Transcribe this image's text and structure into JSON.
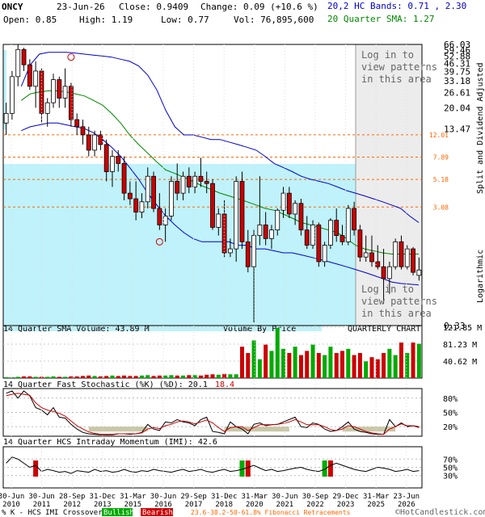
{
  "header": {
    "symbol": "ONCY",
    "date": "23-Jun-26",
    "close": "Close: 0.9409",
    "change": "Change: 0.09 (+10.6 %)",
    "open": "Open: 0.85",
    "high": "High: 1.19",
    "low": "Low: 0.77",
    "vol": "Vol: 76,895,600",
    "bands": "20,2 HC Bands: 0.71 , 2.30",
    "sma": "20 Quarter SMA: 1.27"
  },
  "side": {
    "adjusted": "Split and Dividend Adjusted",
    "scale": "Logarithmic"
  },
  "overlay": {
    "login": [
      "Log in to",
      "view patterns",
      "in this area"
    ]
  },
  "colors": {
    "up": "#00aa00",
    "down": "#cc0000",
    "cyan": "#bff2fa",
    "upper_band": "#0000cc",
    "sma": "#008800",
    "fib": "#ff6600",
    "shade": "#ececec",
    "stoch_fill": "#c8c8a8"
  },
  "chart_data": [
    {
      "type": "candlestick",
      "title": "",
      "scale": "log",
      "ylim": [
        0.33,
        66.03
      ],
      "price_ticks": [
        66.03,
        59.46,
        52.88,
        46.31,
        39.75,
        33.18,
        26.61,
        20.04,
        13.47,
        0.33
      ],
      "fib_levels": [
        12.01,
        7.89,
        5.18,
        3.08
      ],
      "x_tick_labels": [
        "30-Jun 2010",
        "30-Jun 2011",
        "28-Sep 2012",
        "31-Dec 2013",
        "31-Mar 2015",
        "30-Jun 2016",
        "29-Sep 2017",
        "31-Dec 2018",
        "31-Mar 2020",
        "30-Jun 2021",
        "30-Sep 2022",
        "29-Dec 2023",
        "31-Mar 2025",
        "23-Jun 2026"
      ],
      "candles": [
        [
          15,
          22,
          12,
          18
        ],
        [
          18,
          40,
          16,
          36
        ],
        [
          36,
          66,
          30,
          60
        ],
        [
          60,
          62,
          40,
          45
        ],
        [
          45,
          50,
          28,
          30
        ],
        [
          30,
          48,
          20,
          40
        ],
        [
          40,
          42,
          15,
          18
        ],
        [
          18,
          24,
          14,
          22
        ],
        [
          22,
          38,
          20,
          34
        ],
        [
          34,
          36,
          20,
          24
        ],
        [
          24,
          42,
          20,
          30
        ],
        [
          30,
          32,
          14,
          16
        ],
        [
          16,
          18,
          12,
          14
        ],
        [
          14,
          16,
          10,
          12
        ],
        [
          12,
          14,
          8,
          9
        ],
        [
          9,
          13,
          8,
          12
        ],
        [
          12,
          13,
          9,
          10
        ],
        [
          10,
          11,
          5,
          6
        ],
        [
          6,
          9,
          4.5,
          8
        ],
        [
          8,
          9,
          6,
          7
        ],
        [
          7,
          8,
          3.5,
          4
        ],
        [
          4,
          5,
          3.2,
          3.6
        ],
        [
          3.6,
          5,
          2.4,
          2.8
        ],
        [
          2.8,
          4,
          2.5,
          3.4
        ],
        [
          3.4,
          6.5,
          3,
          5.5
        ],
        [
          5.5,
          6,
          2.8,
          3.0
        ],
        [
          3.0,
          4.0,
          2.0,
          2.2
        ],
        [
          2.2,
          3.0,
          1.6,
          2.6
        ],
        [
          2.6,
          5.5,
          2.4,
          5.0
        ],
        [
          5.0,
          7.0,
          3.5,
          4.0
        ],
        [
          4.0,
          6.0,
          3.5,
          5.5
        ],
        [
          5.5,
          6.5,
          4.0,
          4.5
        ],
        [
          4.5,
          6.0,
          4.0,
          5.5
        ],
        [
          5.5,
          7.8,
          4.5,
          5.0
        ],
        [
          5.0,
          6.0,
          4.0,
          4.8
        ],
        [
          4.8,
          5.2,
          2.0,
          2.1
        ],
        [
          2.1,
          3.0,
          1.8,
          2.7
        ],
        [
          2.7,
          3.5,
          1.2,
          1.3
        ],
        [
          1.3,
          1.7,
          1.2,
          1.4
        ],
        [
          1.4,
          5.5,
          1.1,
          5.0
        ],
        [
          5.0,
          6.0,
          1.4,
          1.6
        ],
        [
          1.6,
          2.0,
          0.9,
          1.0
        ],
        [
          1.0,
          2.0,
          0.35,
          1.8
        ],
        [
          1.8,
          5.5,
          1.5,
          2.2
        ],
        [
          2.2,
          2.8,
          1.5,
          1.7
        ],
        [
          1.7,
          2.2,
          1.4,
          2.0
        ],
        [
          2.0,
          3.0,
          1.8,
          2.9
        ],
        [
          2.9,
          4.5,
          2.5,
          4.0
        ],
        [
          4.0,
          4.5,
          2.5,
          2.7
        ],
        [
          2.7,
          3.5,
          2.2,
          3.3
        ],
        [
          3.3,
          3.6,
          1.8,
          2.0
        ],
        [
          2.0,
          2.6,
          1.4,
          1.5
        ],
        [
          1.5,
          2.4,
          1.4,
          2.2
        ],
        [
          2.2,
          2.3,
          1.0,
          1.1
        ],
        [
          1.1,
          1.6,
          1.0,
          1.5
        ],
        [
          1.5,
          2.5,
          1.4,
          2.4
        ],
        [
          2.4,
          3.0,
          1.6,
          1.8
        ],
        [
          1.8,
          2.2,
          1.5,
          1.6
        ],
        [
          1.6,
          3.2,
          1.5,
          3.0
        ],
        [
          3.0,
          3.4,
          1.8,
          2.0
        ],
        [
          2.0,
          2.2,
          1.1,
          1.2
        ],
        [
          1.2,
          1.8,
          1.1,
          1.3
        ],
        [
          1.3,
          1.8,
          1.0,
          1.1
        ],
        [
          1.1,
          1.5,
          0.95,
          1.0
        ],
        [
          1.0,
          1.4,
          0.5,
          0.8
        ],
        [
          0.8,
          1.1,
          0.6,
          1.0
        ],
        [
          1.0,
          1.7,
          0.95,
          1.6
        ],
        [
          1.6,
          1.8,
          0.95,
          1.0
        ],
        [
          1.0,
          1.5,
          0.95,
          1.4
        ],
        [
          1.4,
          1.45,
          0.85,
          0.9
        ],
        [
          0.85,
          1.19,
          0.77,
          0.94
        ]
      ],
      "series": [
        {
          "name": "20,2 HC Bands (upper)",
          "values": [
            null,
            null,
            30,
            45,
            55,
            57,
            57,
            57,
            56,
            55,
            54,
            53,
            52,
            50,
            48,
            44,
            37,
            28,
            19,
            14,
            12,
            12,
            11.5,
            11,
            11,
            10.5,
            10,
            9.5,
            9,
            8,
            7,
            6.5,
            6,
            5.5,
            5.2,
            5,
            4.8,
            4.5,
            4.2,
            4,
            3.8,
            3.6,
            3.4,
            3.2,
            3.0,
            2.6,
            2.3
          ]
        },
        {
          "name": "20 Quarter SMA",
          "values": [
            null,
            null,
            23,
            26,
            27,
            27.5,
            27.5,
            27,
            26,
            25,
            23,
            21,
            18,
            15,
            12,
            10,
            8.5,
            7.2,
            6.2,
            5.8,
            5.4,
            5.0,
            4.6,
            4.3,
            4.0,
            3.8,
            3.6,
            3.4,
            3.2,
            3.0,
            2.9,
            2.7,
            2.5,
            2.3,
            2.2,
            2.1,
            2.0,
            1.9,
            1.7,
            1.5,
            1.4,
            1.35,
            1.3,
            1.27,
            1.27,
            1.27,
            1.27
          ]
        },
        {
          "name": "20,2 HC Bands (lower)",
          "values": [
            null,
            null,
            13,
            14,
            14.5,
            15,
            15,
            14.5,
            14,
            13.5,
            12.5,
            11,
            9.5,
            8,
            6.5,
            5.2,
            4,
            3.2,
            2.6,
            2.2,
            1.9,
            1.7,
            1.6,
            1.6,
            1.6,
            1.6,
            1.5,
            1.5,
            1.4,
            1.4,
            1.35,
            1.3,
            1.3,
            1.25,
            1.2,
            1.15,
            1.1,
            1.05,
            1.0,
            0.95,
            0.9,
            0.85,
            0.8,
            0.75,
            0.73,
            0.72,
            0.71
          ]
        }
      ]
    },
    {
      "type": "bar",
      "title": "14 Quarter SMA Volume: 43.89 M",
      "subtitle": "Volume By Price",
      "label": "QUARTERLY CHART",
      "ylim": [
        0,
        121.85
      ],
      "y_ticks": [
        121.85,
        81.23,
        40.62
      ],
      "y_tick_labels": [
        "121.85 M",
        "81.23 M",
        "40.62 M"
      ],
      "values": [
        2,
        2,
        3,
        4,
        4,
        3,
        3,
        3,
        4,
        3,
        3,
        4,
        4,
        5,
        6,
        5,
        4,
        5,
        6,
        5,
        6,
        5,
        5,
        6,
        7,
        5,
        6,
        6,
        7,
        6,
        6,
        7,
        7,
        6,
        8,
        9,
        8,
        10,
        9,
        9,
        75,
        60,
        90,
        45,
        80,
        65,
        120,
        70,
        60,
        75,
        55,
        65,
        80,
        60,
        55,
        75,
        60,
        65,
        70,
        55,
        60,
        40,
        50,
        45,
        60,
        70,
        55,
        85,
        60,
        85,
        82
      ]
    },
    {
      "type": "line",
      "title": "14 Quarter Fast Stochastic (%K) (%D): 20.1",
      "value_d": "18.4",
      "ylim": [
        0,
        100
      ],
      "y_ticks": [
        80,
        50,
        20
      ],
      "y_tick_labels": [
        "80%",
        "50%",
        "20%"
      ],
      "series": [
        {
          "name": "%K",
          "values": [
            90,
            95,
            80,
            95,
            85,
            60,
            55,
            45,
            60,
            40,
            38,
            25,
            15,
            8,
            5,
            4,
            3,
            3,
            3,
            5,
            5,
            4,
            5,
            8,
            25,
            15,
            12,
            30,
            28,
            35,
            30,
            28,
            22,
            35,
            40,
            10,
            8,
            5,
            30,
            20,
            15,
            5,
            25,
            28,
            22,
            24,
            25,
            30,
            35,
            40,
            20,
            18,
            28,
            25,
            15,
            10,
            12,
            20,
            30,
            15,
            10,
            8,
            5,
            4,
            4,
            35,
            20,
            28,
            20,
            22,
            20
          ]
        },
        {
          "name": "%D",
          "values": [
            85,
            88,
            90,
            88,
            86,
            70,
            60,
            55,
            52,
            48,
            42,
            32,
            22,
            15,
            9,
            6,
            4,
            4,
            4,
            5,
            5,
            5,
            5,
            7,
            15,
            18,
            16,
            22,
            25,
            30,
            32,
            30,
            26,
            30,
            34,
            28,
            18,
            10,
            18,
            20,
            20,
            12,
            18,
            24,
            24,
            24,
            25,
            27,
            30,
            35,
            30,
            24,
            24,
            24,
            20,
            14,
            12,
            15,
            22,
            20,
            15,
            10,
            7,
            5,
            4,
            15,
            20,
            26,
            22,
            22,
            18
          ]
        }
      ]
    },
    {
      "type": "line",
      "title": "14 Quarter HCS Intraday Momentum (IMI): 42.6",
      "ylim": [
        0,
        100
      ],
      "y_ticks": [
        70,
        50,
        30
      ],
      "y_tick_labels": [
        "70%",
        "50%",
        "30%"
      ],
      "series": [
        {
          "name": "IMI",
          "values": [
            60,
            75,
            70,
            60,
            50,
            55,
            40,
            45,
            42,
            38,
            40,
            35,
            42,
            40,
            38,
            45,
            40,
            42,
            38,
            40,
            45,
            40,
            38,
            42,
            40,
            45,
            42,
            40,
            38,
            42,
            45,
            40,
            42,
            45,
            40,
            38,
            42,
            45,
            40,
            42,
            45,
            50,
            55,
            48,
            42,
            45,
            40,
            42,
            45,
            48,
            50,
            45,
            42,
            40,
            45,
            55,
            60,
            55,
            50,
            45,
            42,
            40,
            45,
            50,
            48,
            45,
            40,
            42,
            45,
            40,
            42
          ]
        }
      ]
    }
  ],
  "footer": {
    "legend_prefix": "% K - HCS IMI Crossover:",
    "bullish": "Bullish",
    "bearish": "Bearish",
    "fib": "23.6-38.2-50-61.8% Fibonacci Retracements",
    "copyright": "©HotCandlestick.com"
  }
}
